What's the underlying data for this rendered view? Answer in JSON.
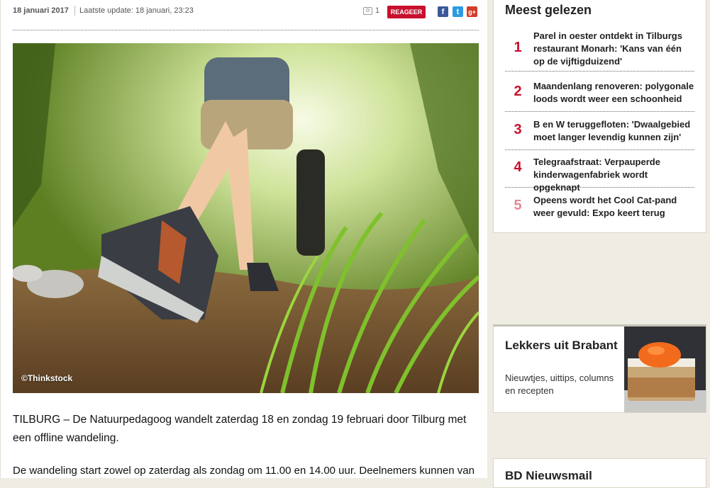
{
  "article": {
    "date": "18 januari 2017",
    "last_update": "Laatste update: 18 januari, 23:23",
    "photo_count": "1",
    "react_label": "REAGEER",
    "social": {
      "facebook": "f",
      "twitter": "t",
      "googleplus": "g+"
    },
    "image_credit": "©Thinkstock",
    "lead": "TILBURG – De Natuurpedagoog wandelt zaterdag 18 en zondag 19 februari door Tilburg met een offline wandeling.",
    "paragraph": "De wandeling start zowel op zaterdag als zondag om 11.00 en 14.00 uur. Deelnemers kunnen van"
  },
  "sidebar": {
    "most_read_title": "Meest gelezen",
    "most_read": [
      {
        "num": "1",
        "title": "Parel in oester ontdekt in Tilburgs restaurant Monarh: 'Kans van één op de vijftigduizend'"
      },
      {
        "num": "2",
        "title": "Maandenlang renoveren: polygonale loods wordt weer een schoonheid"
      },
      {
        "num": "3",
        "title": "B en W teruggefloten: 'Dwaalgebied moet langer levendig kunnen zijn'"
      },
      {
        "num": "4",
        "title": "Telegraafstraat: Verpauperde kinderwagenfabriek wordt opgeknapt"
      },
      {
        "num": "5",
        "title": "Opeens wordt het Cool Cat-pand weer gevuld: Expo keert terug"
      }
    ],
    "food_box": {
      "title": "Lekkers uit Brabant",
      "subtitle": "Nieuwtjes, uittips, columns en recepten"
    },
    "newsletter_title": "BD Nieuwsmail"
  },
  "colors": {
    "accent": "#c8102e",
    "background": "#efece4"
  }
}
